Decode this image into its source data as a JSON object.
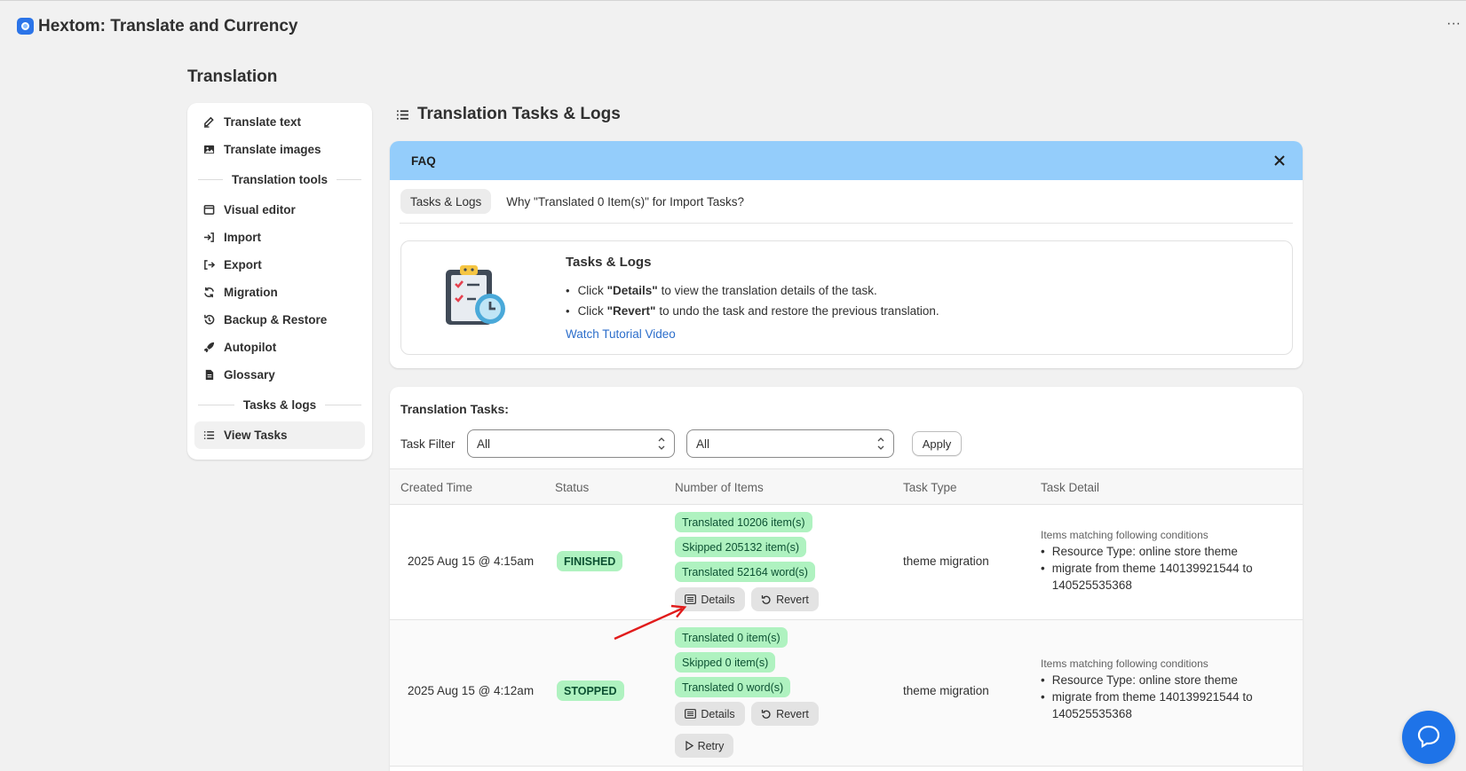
{
  "app": {
    "title": "Hextom: Translate and Currency",
    "more_label": "···",
    "brand_color": "#2b74e8"
  },
  "page": {
    "title": "Translation"
  },
  "sidebar": {
    "items_top": [
      {
        "label": "Translate text",
        "icon": "edit-icon"
      },
      {
        "label": "Translate images",
        "icon": "image-icon"
      }
    ],
    "section_tools": "Translation tools",
    "items_tools": [
      {
        "label": "Visual editor",
        "icon": "window-icon"
      },
      {
        "label": "Import",
        "icon": "import-icon"
      },
      {
        "label": "Export",
        "icon": "export-icon"
      },
      {
        "label": "Migration",
        "icon": "refresh-icon"
      },
      {
        "label": "Backup & Restore",
        "icon": "history-icon"
      },
      {
        "label": "Autopilot",
        "icon": "rocket-icon"
      },
      {
        "label": "Glossary",
        "icon": "document-icon"
      }
    ],
    "section_tasks": "Tasks & logs",
    "items_tasks": [
      {
        "label": "View Tasks",
        "icon": "list-icon",
        "active": true
      }
    ]
  },
  "main": {
    "title": "Translation Tasks & Logs"
  },
  "faq": {
    "header": "FAQ",
    "header_color": "#94cdfb",
    "tabs": [
      {
        "label": "Tasks & Logs",
        "active": true
      },
      {
        "label": "Why \"Translated 0 Item(s)\" for Import Tasks?",
        "active": false
      }
    ],
    "body_title": "Tasks & Logs",
    "bullets": [
      {
        "prefix": "Click",
        "bold": "\"Details\"",
        "rest": "to view the translation details of the task."
      },
      {
        "prefix": "Click",
        "bold": "\"Revert\"",
        "rest": "to undo the task and restore the previous translation."
      }
    ],
    "link": "Watch Tutorial Video"
  },
  "tasks": {
    "title": "Translation Tasks:",
    "filter_label": "Task Filter",
    "filter1_value": "All",
    "filter2_value": "All",
    "apply_label": "Apply",
    "columns": [
      "Created Time",
      "Status",
      "Number of Items",
      "Task Type",
      "Task Detail"
    ],
    "rows": [
      {
        "created": "2025 Aug 15 @ 4:15am",
        "status": "FINISHED",
        "items": [
          "Translated 10206 item(s)",
          "Skipped 205132 item(s)",
          "Translated 52164 word(s)"
        ],
        "type": "theme migration",
        "detail_head": "Items matching following conditions",
        "detail_items": [
          "Resource Type: online store theme",
          "migrate from theme 140139921544 to 140525535368"
        ],
        "buttons": [
          "Details",
          "Revert"
        ]
      },
      {
        "created": "2025 Aug 15 @ 4:12am",
        "status": "STOPPED",
        "items": [
          "Translated 0 item(s)",
          "Skipped 0 item(s)",
          "Translated 0 word(s)"
        ],
        "type": "theme migration",
        "detail_head": "Items matching following conditions",
        "detail_items": [
          "Resource Type: online store theme",
          "migrate from theme 140139921544 to 140525535368"
        ],
        "buttons": [
          "Details",
          "Revert"
        ],
        "retry_label": "Retry"
      }
    ],
    "badge_color": "#aff2c0"
  }
}
